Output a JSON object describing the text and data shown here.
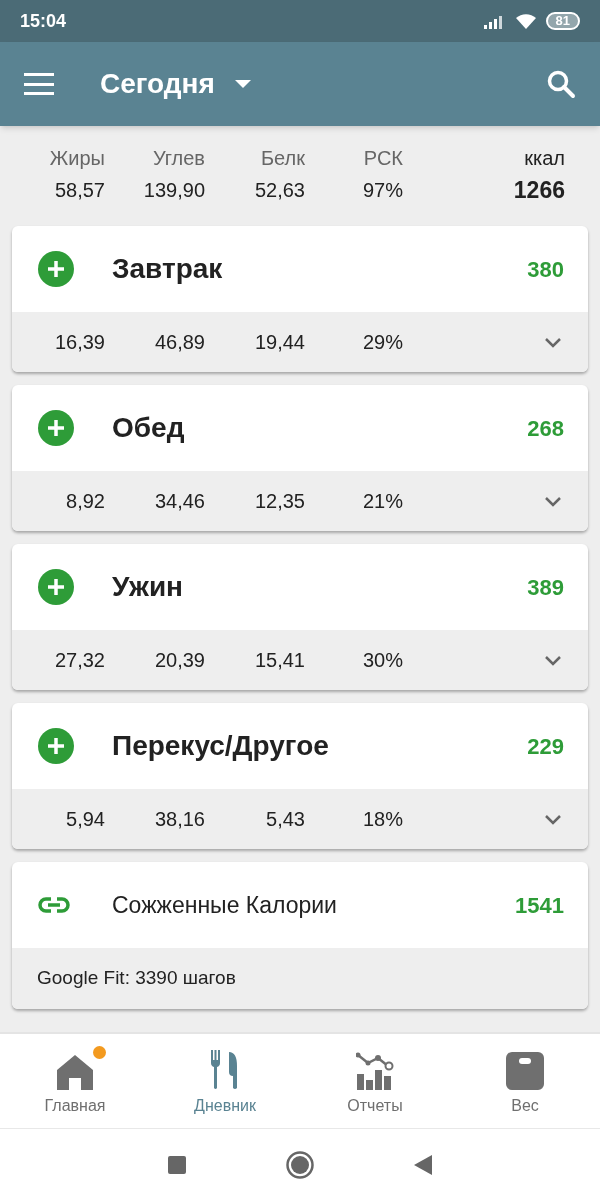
{
  "status_bar": {
    "time": "15:04",
    "battery": "81"
  },
  "app_bar": {
    "title": "Сегодня"
  },
  "summary": {
    "columns": [
      {
        "label": "Жиры",
        "value": "58,57"
      },
      {
        "label": "Углев",
        "value": "139,90"
      },
      {
        "label": "Белк",
        "value": "52,63"
      },
      {
        "label": "РСК",
        "value": "97%"
      }
    ],
    "kcal_label": "ккал",
    "kcal_value": "1266"
  },
  "meals": [
    {
      "name": "Завтрак",
      "calories": "380",
      "values": [
        "16,39",
        "46,89",
        "19,44",
        "29%"
      ]
    },
    {
      "name": "Обед",
      "calories": "268",
      "values": [
        "8,92",
        "34,46",
        "12,35",
        "21%"
      ]
    },
    {
      "name": "Ужин",
      "calories": "389",
      "values": [
        "27,32",
        "20,39",
        "15,41",
        "30%"
      ]
    },
    {
      "name": "Перекус/Другое",
      "calories": "229",
      "values": [
        "5,94",
        "38,16",
        "5,43",
        "18%"
      ]
    }
  ],
  "burned": {
    "label": "Сожженные Калории",
    "calories": "1541",
    "steps": "Google Fit: 3390 шагов"
  },
  "bottom_nav": [
    {
      "label": "Главная",
      "kind": "home",
      "selected": false,
      "badge": true
    },
    {
      "label": "Дневник",
      "kind": "diary",
      "selected": true,
      "badge": false
    },
    {
      "label": "Отчеты",
      "kind": "reports",
      "selected": false,
      "badge": false
    },
    {
      "label": "Вес",
      "kind": "scale",
      "selected": false,
      "badge": false
    }
  ]
}
